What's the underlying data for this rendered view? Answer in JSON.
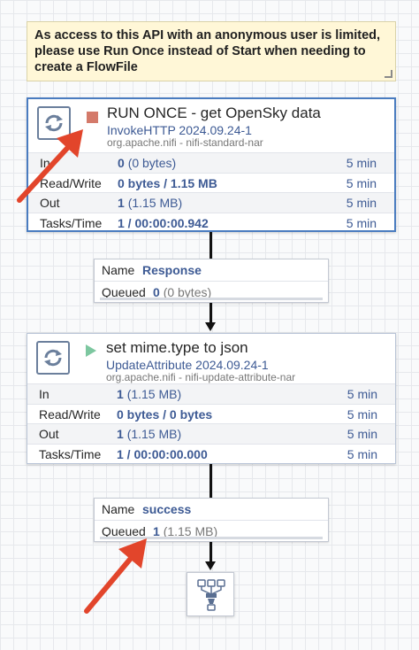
{
  "note": {
    "text": "As access to this API with an anonymous user is limited, please use Run Once instead of Start when needing to create a FlowFile"
  },
  "processors": [
    {
      "name": "RUN ONCE - get OpenSky data",
      "type": "InvokeHTTP 2024.09.24-1",
      "bundle": "org.apache.nifi - nifi-standard-nar",
      "status_icon": "stop-icon",
      "stats": {
        "in": {
          "label": "In",
          "count": "0",
          "size": "(0 bytes)",
          "time": "5 min"
        },
        "read_write": {
          "label": "Read/Write",
          "read": "0 bytes",
          "sep": " / ",
          "write": "1.15 MB",
          "time": "5 min"
        },
        "out": {
          "label": "Out",
          "count": "1",
          "size": "(1.15 MB)",
          "time": "5 min"
        },
        "tasks": {
          "label": "Tasks/Time",
          "count": "1",
          "sep": " / ",
          "duration": "00:00:00.942",
          "time": "5 min"
        }
      }
    },
    {
      "name": "set mime.type to json",
      "type": "UpdateAttribute 2024.09.24-1",
      "bundle": "org.apache.nifi - nifi-update-attribute-nar",
      "status_icon": "play-icon",
      "stats": {
        "in": {
          "label": "In",
          "count": "1",
          "size": "(1.15 MB)",
          "time": "5 min"
        },
        "read_write": {
          "label": "Read/Write",
          "read": "0 bytes",
          "sep": " / ",
          "write": "0 bytes",
          "time": "5 min"
        },
        "out": {
          "label": "Out",
          "count": "1",
          "size": "(1.15 MB)",
          "time": "5 min"
        },
        "tasks": {
          "label": "Tasks/Time",
          "count": "1",
          "sep": " / ",
          "duration": "00:00:00.000",
          "time": "5 min"
        }
      }
    }
  ],
  "connections": [
    {
      "name_key": "Name",
      "name": "Response",
      "queued_key": "Queued",
      "queued_count": "0",
      "queued_size": "(0 bytes)"
    },
    {
      "name_key": "Name",
      "name": "success",
      "queued_key": "Queued",
      "queued_count": "1",
      "queued_size": "(1.15 MB)"
    }
  ],
  "funnel": {
    "icon": "funnel-icon"
  },
  "colors": {
    "annotation": "#e2452b",
    "accent": "#3d5a94",
    "note_bg": "#fff7d7"
  }
}
